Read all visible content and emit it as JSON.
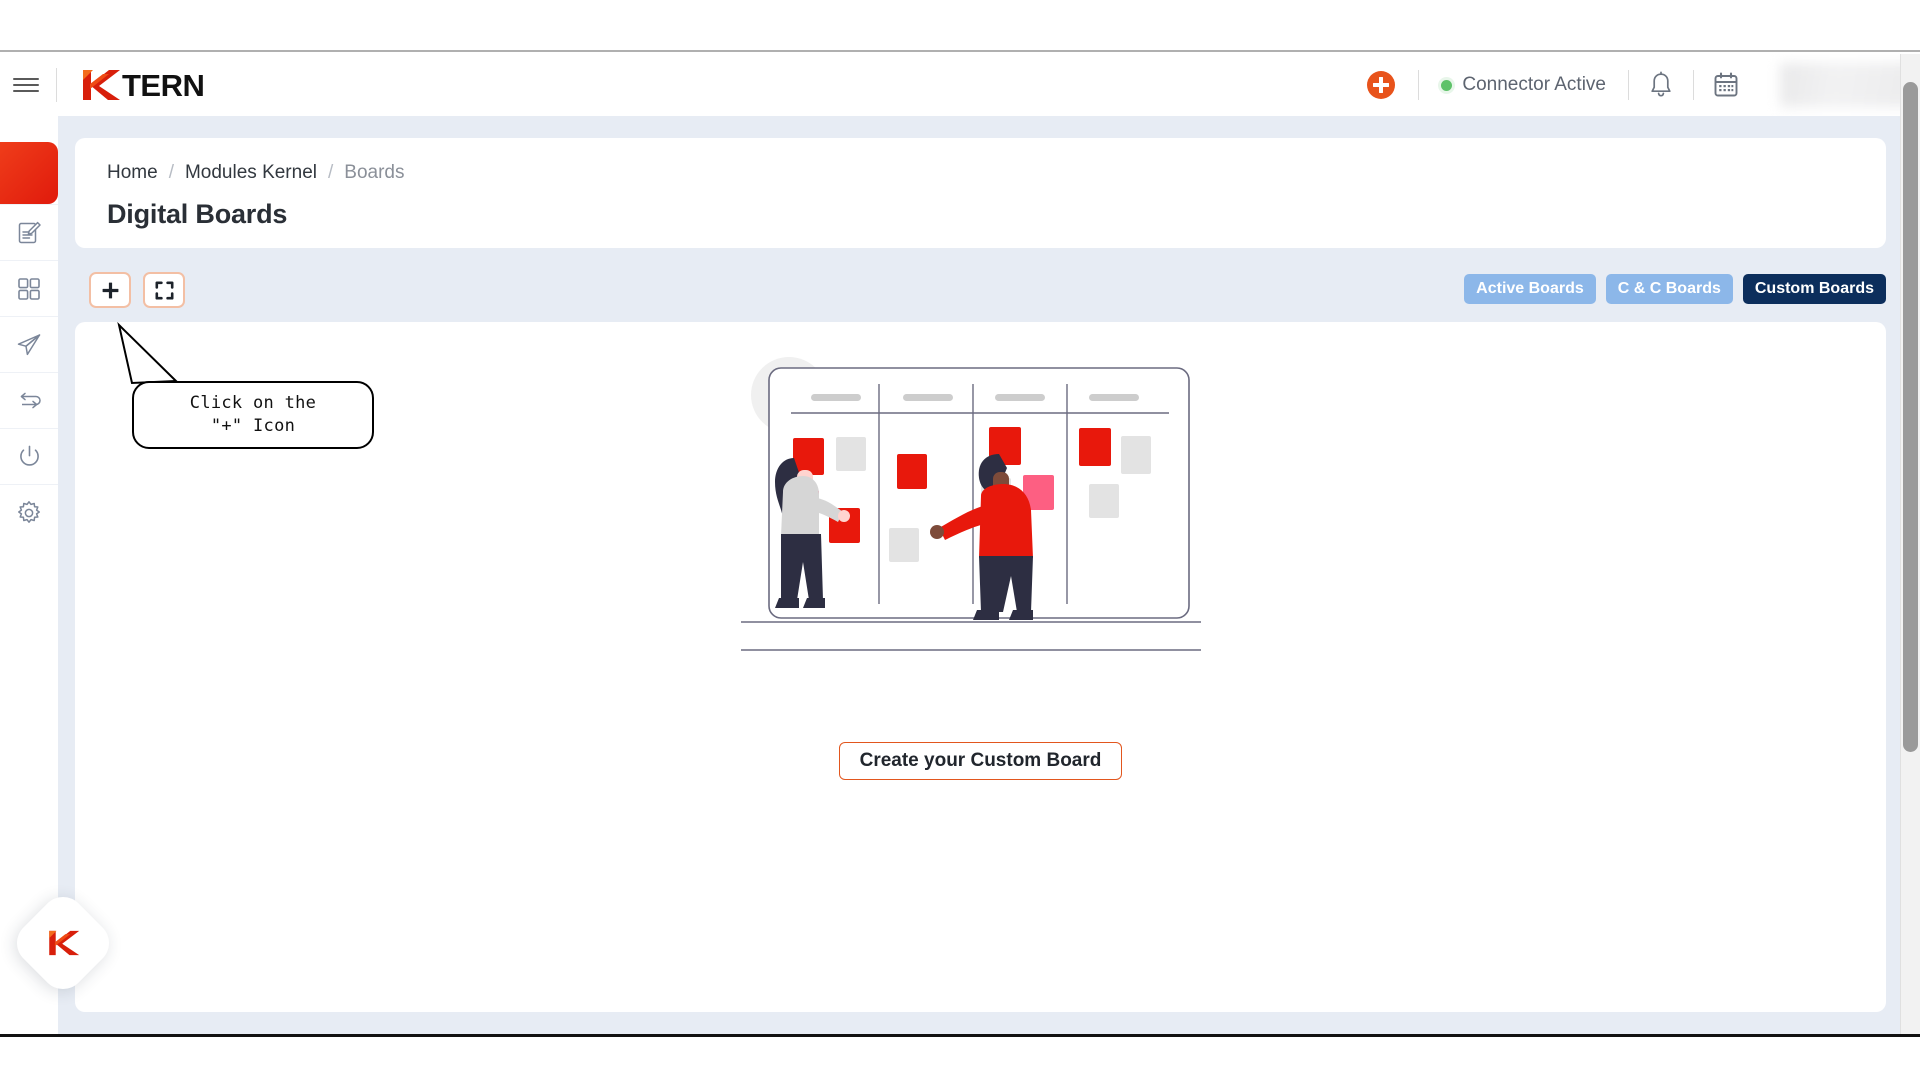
{
  "header": {
    "menu_icon": "hamburger-icon",
    "brand_name": "TERN",
    "brand_mark": "k-logo-icon",
    "add_icon": "add-circle-icon",
    "connector_status_label": "Connector Active",
    "connector_status_color": "#5ec269",
    "notifications_icon": "bell-icon",
    "calendar_icon": "calendar-icon",
    "profile_label": ""
  },
  "sidebar": {
    "items": [
      {
        "name": "sidebar-item-active-block",
        "icon": "active-block",
        "label": ""
      },
      {
        "name": "sidebar-item-documents",
        "icon": "edit-document-icon",
        "label": ""
      },
      {
        "name": "sidebar-item-apps",
        "icon": "grid-apps-icon",
        "label": ""
      },
      {
        "name": "sidebar-item-send",
        "icon": "paper-plane-icon",
        "label": ""
      },
      {
        "name": "sidebar-item-sync",
        "icon": "sync-arrows-icon",
        "label": ""
      },
      {
        "name": "sidebar-item-power",
        "icon": "power-icon",
        "label": ""
      },
      {
        "name": "sidebar-item-settings",
        "icon": "gear-icon",
        "label": ""
      }
    ]
  },
  "breadcrumb": {
    "home": "Home",
    "sep1": "/",
    "section": "Modules Kernel",
    "sep2": "/",
    "current": "Boards"
  },
  "page": {
    "title": "Digital Boards"
  },
  "toolbar": {
    "add_button_icon": "plus-icon",
    "fullscreen_button_icon": "fullscreen-expand-icon",
    "filters": [
      {
        "label": "Active Boards",
        "active": false
      },
      {
        "label": "C & C Boards",
        "active": false
      },
      {
        "label": "Custom Boards",
        "active": true
      }
    ]
  },
  "empty_state": {
    "illustration": "kanban-board-people-illustration",
    "create_button_label": "Create your Custom Board"
  },
  "annotation": {
    "line1": "Click on the",
    "line2": "\"+\" Icon"
  },
  "floating_button": {
    "icon": "ktern-k-logo-icon"
  },
  "colors": {
    "brand_red": "#e01a0c",
    "brand_orange": "#ef3d1a",
    "accent_border": "#f3bfa4",
    "filter_inactive": "#8cb7e9",
    "filter_active": "#0c2e5c",
    "page_background": "#e7ecf4",
    "status_green": "#5ec269",
    "create_button_border": "#e2561e"
  }
}
